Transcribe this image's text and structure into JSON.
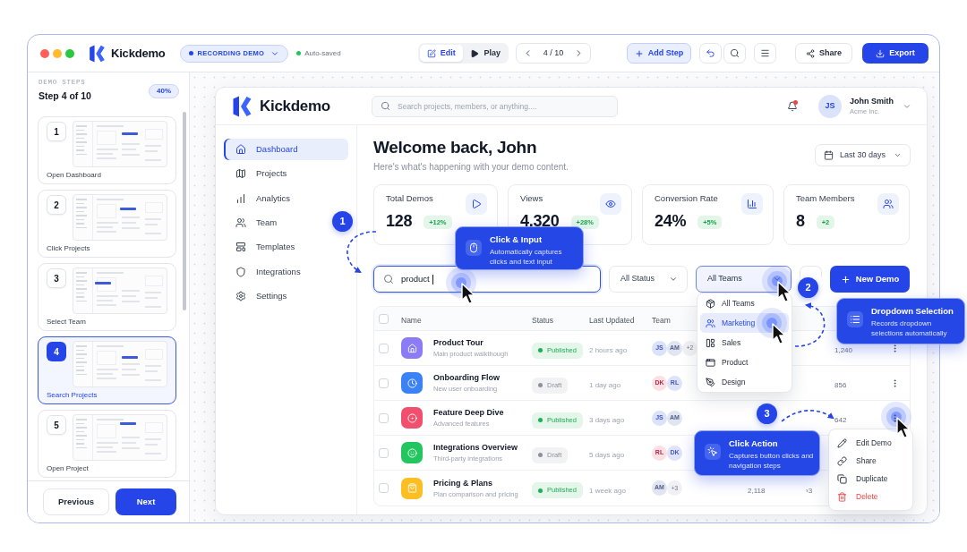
{
  "toolbar": {
    "brand": "Kickdemo",
    "recording_badge": "RECORDING DEMO",
    "save_status": "Auto-saved",
    "modes": [
      {
        "label": "Edit",
        "selected": true
      },
      {
        "label": "Play",
        "selected": false
      }
    ],
    "pager": "4 / 10",
    "add_step": "Add Step",
    "share": "Share",
    "export": "Export"
  },
  "sidebar": {
    "heading": "DEMO STEPS",
    "progress": "Step 4 of 10",
    "percent": "40%",
    "steps": [
      {
        "number": "1",
        "label": "Open Dashboard",
        "selected": false
      },
      {
        "number": "2",
        "label": "Click Projects",
        "selected": false
      },
      {
        "number": "3",
        "label": "Select Team",
        "selected": false
      },
      {
        "number": "4",
        "label": "Search Projects",
        "selected": true
      },
      {
        "number": "5",
        "label": "Open Project",
        "selected": false
      }
    ],
    "previous": "Previous",
    "next": "Next"
  },
  "app": {
    "brand": "Kickdemo",
    "search": {
      "placeholder": "Search projects, members, or anything...."
    },
    "notifications": {
      "unread": true
    },
    "user": {
      "initials": "JS",
      "name": "John Smith",
      "org": "Acme Inc."
    },
    "nav": [
      {
        "label": "Dashboard",
        "selected": true
      },
      {
        "label": "Projects",
        "selected": false
      },
      {
        "label": "Analytics",
        "selected": false
      },
      {
        "label": "Team",
        "selected": false
      },
      {
        "label": "Templates",
        "selected": false
      },
      {
        "label": "Integrations",
        "selected": false
      },
      {
        "label": "Settings",
        "selected": false
      }
    ],
    "greeting": "Welcome back, John",
    "subtitle": "Here's what's happening with your demo content.",
    "date_range": "Last 30 days",
    "stats": [
      {
        "label": "Total Demos",
        "value": "128",
        "change": "+12%"
      },
      {
        "label": "Views",
        "value": "4,320",
        "change": "+28%"
      },
      {
        "label": "Conversion Rate",
        "value": "24%",
        "change": "+5%"
      },
      {
        "label": "Team Members",
        "value": "8",
        "change": "+2"
      }
    ],
    "filters": {
      "search": {
        "value": "product",
        "focused": true
      },
      "status": "All Status",
      "team": {
        "value": "All Teams",
        "expanded": true
      },
      "new_demo": "New Demo"
    },
    "table": {
      "header_checked": false,
      "columns": [
        "Name",
        "Status",
        "Last Updated",
        "Team"
      ],
      "rows": [
        {
          "checked": false,
          "color": "#8b7cf6",
          "title": "Product Tour",
          "subtitle": "Main product walkthough",
          "status": {
            "label": "Published",
            "color": "#1fae55"
          },
          "updated": "2 hours ago",
          "team": [
            {
              "initials": "JS",
              "color": "#dbe3fb"
            },
            {
              "initials": "AM",
              "color": "#e1e5ef"
            }
          ],
          "more": "+2",
          "column_8": "1,240",
          "actions": true
        },
        {
          "checked": false,
          "color": "#3b82f6",
          "title": "Onboarding Flow",
          "subtitle": "New user onboarding",
          "status": {
            "label": "Draft",
            "color": "#8b929e"
          },
          "updated": "1 day ago",
          "team": [
            {
              "initials": "DK",
              "color": "#fde0e3"
            },
            {
              "initials": "RL",
              "color": "#dde3f8"
            }
          ],
          "column_8": "856",
          "actions": true
        },
        {
          "checked": false,
          "color": "#f0506e",
          "title": "Feature Deep Dive",
          "subtitle": "Advanced features",
          "status": {
            "label": "Published",
            "color": "#1fae55"
          },
          "updated": "3 days ago",
          "team": [
            {
              "initials": "JS",
              "color": "#dbe3fb"
            },
            {
              "initials": "AM",
              "color": "#e1e5ef"
            }
          ],
          "column_8": "642",
          "actions": true
        },
        {
          "checked": false,
          "color": "#22c55e",
          "title": "Integrations Overview",
          "subtitle": "Third-party integrations",
          "status": {
            "label": "Draft",
            "color": "#8b929e"
          },
          "updated": "5 days ago",
          "team": [
            {
              "initials": "RL",
              "color": "#fde0e3"
            },
            {
              "initials": "DK",
              "color": "#dde3f8"
            }
          ]
        },
        {
          "checked": false,
          "color": "#fbbf24",
          "title": "Pricing & Plans",
          "subtitle": "Plan comparison and pricing",
          "status": {
            "label": "Published",
            "color": "#1fae55"
          },
          "updated": "1 week ago",
          "team": [
            {
              "initials": "AM",
              "color": "#e1e5ef"
            }
          ],
          "more": "+3",
          "column_6": "2,118",
          "column_7": "›3"
        }
      ]
    },
    "team_menu": [
      {
        "label": "All Teams",
        "selected": false
      },
      {
        "label": "Marketing",
        "selected": true
      },
      {
        "label": "Sales",
        "selected": false
      },
      {
        "label": "Product",
        "selected": false
      },
      {
        "label": "Design",
        "selected": false
      }
    ],
    "row_menu": [
      {
        "label": "Edit Demo",
        "kind": "default"
      },
      {
        "label": "Share",
        "kind": "default"
      },
      {
        "label": "Duplicate",
        "kind": "default"
      },
      {
        "label": "Delete",
        "kind": "danger"
      }
    ]
  },
  "annotations": [
    {
      "number": "1",
      "title": "Click & Input",
      "description": "Automatically captures clicks and text input"
    },
    {
      "number": "2",
      "title": "Dropdown Selection",
      "description": "Records dropdown selections automatically"
    },
    {
      "number": "3",
      "title": "Click Action",
      "description": "Captures button clicks and navigation steps"
    }
  ]
}
